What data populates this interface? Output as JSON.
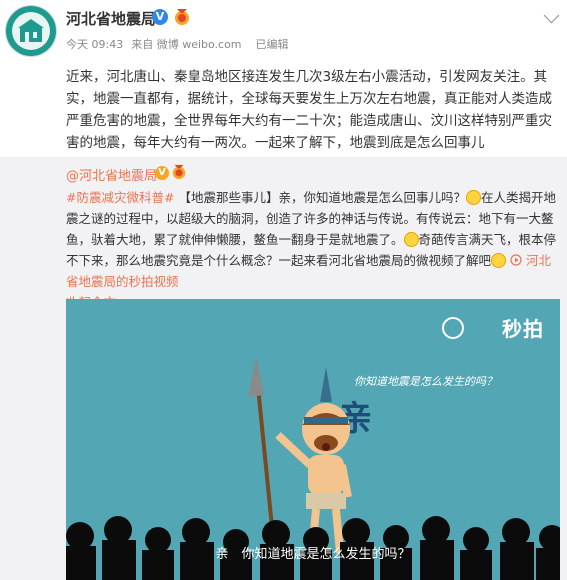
{
  "post": {
    "author": "河北省地震局",
    "verified_symbol": "V",
    "time": "今天 09:43",
    "source": "来自 微博 weibo.com",
    "edited": "已编辑",
    "text": "近来，河北唐山、秦皇岛地区接连发生几次3级左右小震活动，引发网友关注。其实，地震一直都有，据统计，全球每天要发生上万次左右地震，真正能对人类造成严重危害的地震，全世界每年大约有一二十次；能造成唐山、汶川这样特别严重灾害的地震，每年大约有一两次。一起来了解下，地震到底是怎么回事儿"
  },
  "repost": {
    "author": "@河北省地震局",
    "verified_symbol": "V",
    "hashtag": "#防震减灾微科普#",
    "text_1": "【地震那些事儿】亲，你知道地震是怎么回事儿吗？",
    "text_2": "在人类揭开地震之谜的过程中，以超级大的脑洞，创造了许多的神话与传说。有传说云：地下有一大鳌鱼，驮着大地，累了就伸伸懒腰，鳌鱼一翻身于是就地震了。",
    "text_3": "奇葩传言满天飞，根本停不下来，那么地震究竟是个什么概念？一起来看河北省地震局的微视频了解吧",
    "video_link": "河北省地震局的秒拍视频",
    "collapse": "收起全文"
  },
  "video": {
    "watermark": "秒拍",
    "question": "你知道地震是怎么发生的吗？",
    "big_char": "亲",
    "caption": "亲　你知道地震是怎么发生的吗？"
  },
  "colors": {
    "link": "#eb7350",
    "video_bg": "#53a6b3",
    "verified": "#2f87e9"
  }
}
